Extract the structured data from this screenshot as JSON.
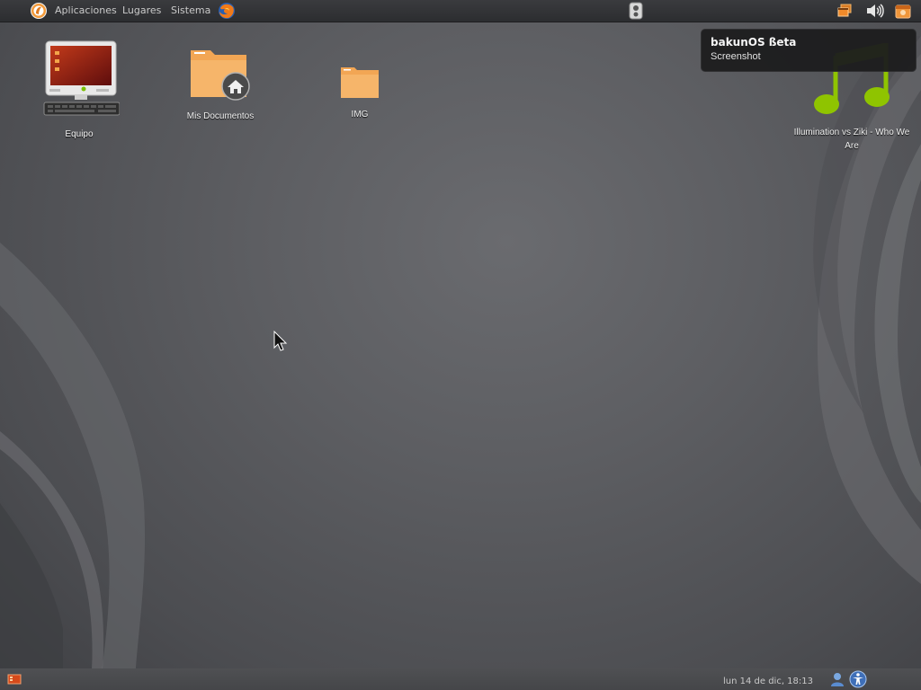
{
  "top_panel": {
    "menus": [
      {
        "label": "Aplicaciones"
      },
      {
        "label": "Lugares"
      },
      {
        "label": "Sistema"
      }
    ]
  },
  "desktop": {
    "icons": [
      {
        "label": "Equipo",
        "icon": "computer-icon"
      },
      {
        "label": "Mis Documentos",
        "icon": "home-folder-icon"
      },
      {
        "label": "IMG",
        "icon": "folder-icon"
      },
      {
        "label": "Illumination vs Ziki - Who We Are",
        "icon": "music-file-icon"
      }
    ]
  },
  "notification": {
    "title": "bakunOS ßeta",
    "body": "Screenshot"
  },
  "bottom_panel": {
    "clock": "lun 14 de dic, 18:13"
  },
  "colors": {
    "accent": "#f08a2a",
    "panel": "#2c2d30",
    "wallpaper": "#58595c",
    "music_green": "#8fc400"
  }
}
